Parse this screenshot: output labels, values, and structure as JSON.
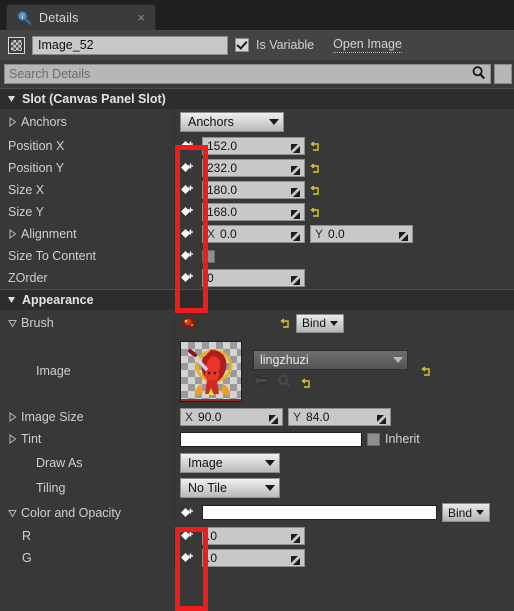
{
  "tab": {
    "label": "Details",
    "icon": "details-magnifier-icon",
    "close": "×"
  },
  "name_row": {
    "icon": "widget-image-icon",
    "value": "Image_52",
    "is_variable_label": "Is Variable",
    "is_variable_checked": true,
    "open_image_link": "Open Image"
  },
  "search": {
    "placeholder": "Search Details",
    "icon": "search-icon",
    "filter_icon": "filter-button"
  },
  "sections": [
    {
      "title": "Slot (Canvas Panel Slot)"
    },
    {
      "title": "Appearance"
    }
  ],
  "slot": {
    "anchors": {
      "label": "Anchors",
      "dropdown": "Anchors"
    },
    "position_x": {
      "label": "Position X",
      "value": "152.0"
    },
    "position_y": {
      "label": "Position Y",
      "value": "232.0"
    },
    "size_x": {
      "label": "Size X",
      "value": "180.0"
    },
    "size_y": {
      "label": "Size Y",
      "value": "168.0"
    },
    "alignment": {
      "label": "Alignment",
      "x_axis": "X",
      "x_value": "0.0",
      "y_axis": "Y",
      "y_value": "0.0"
    },
    "size_to_content": {
      "label": "Size To Content",
      "checked": false
    },
    "zorder": {
      "label": "ZOrder",
      "value": "0"
    }
  },
  "appearance": {
    "brush": {
      "label": "Brush",
      "bind_label": "Bind"
    },
    "image": {
      "label": "Image",
      "asset": "lingzhuzi"
    },
    "image_size": {
      "label": "Image Size",
      "x_axis": "X",
      "x_value": "90.0",
      "y_axis": "Y",
      "y_value": "84.0"
    },
    "tint": {
      "label": "Tint",
      "color": "#ffffff",
      "inherit_label": "Inherit",
      "inherit_checked": false
    },
    "draw_as": {
      "label": "Draw As",
      "value": "Image"
    },
    "tiling": {
      "label": "Tiling",
      "value": "No Tile"
    },
    "color_and_opacity": {
      "label": "Color and Opacity",
      "color": "#ffffff",
      "bind_label": "Bind"
    },
    "r": {
      "label": "R",
      "value": ".0"
    },
    "g": {
      "label": "G",
      "value": ".0"
    }
  },
  "annotations": {
    "color": "#ef1c1c",
    "boxes": [
      {
        "name": "slot-bind-column-highlight"
      },
      {
        "name": "color-bind-column-highlight"
      }
    ]
  }
}
